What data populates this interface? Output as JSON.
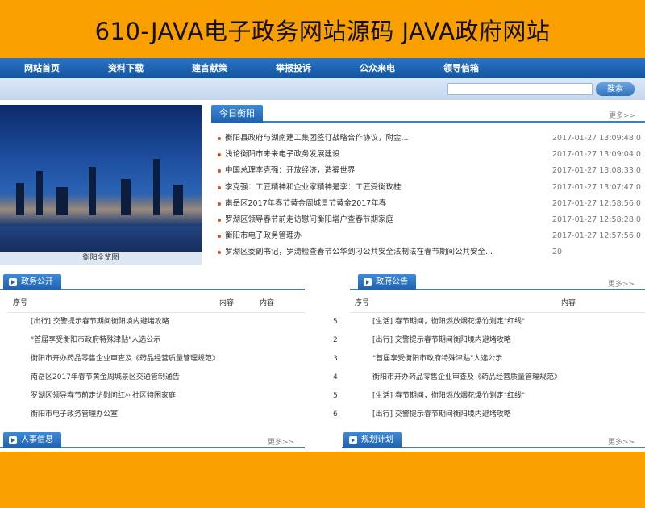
{
  "banner": {
    "title": "610-JAVA电子政务网站源码 JAVA政府网站"
  },
  "nav": {
    "items": [
      "网站首页",
      "资料下载",
      "建言献策",
      "举报投诉",
      "公众来电",
      "领导信箱"
    ]
  },
  "search": {
    "button_label": "搜索",
    "value": ""
  },
  "hero": {
    "caption": "衡阳全览图"
  },
  "news": {
    "tab_label": "今日衡阳",
    "more_label": "更多>>",
    "items": [
      {
        "title": "衡阳县政府与湖南建工集团签订战略合作协议，附金...",
        "date": "2017-01-27 13:09:48.0"
      },
      {
        "title": "浅论衡阳市未来电子政务发展建设",
        "date": "2017-01-27 13:09:04.0"
      },
      {
        "title": "中国总理李克强：开放经济，造福世界",
        "date": "2017-01-27 13:08:33.0"
      },
      {
        "title": "李克强：工匠精神和企业家精神是孪：工匠受衡玫桂",
        "date": "2017-01-27 13:07:47.0"
      },
      {
        "title": "南岳区2017年春节黄金周城景节黄金2017年春",
        "date": "2017-01-27 12:58:56.0"
      },
      {
        "title": "罗湖区领导春节前走访慰问衡阳增户查春节期家庭",
        "date": "2017-01-27 12:58:28.0"
      },
      {
        "title": "衡阳市电子政务管理办",
        "date": "2017-01-27 12:57:56.0"
      },
      {
        "title": "罗湖区委副书记，罗涛检查春节公华到刁公共安全法制法在春节期间公共安全...",
        "date": "20"
      }
    ]
  },
  "gov_open": {
    "tab_label": "政务公开",
    "col_seq": "序号",
    "col_content": "内容",
    "col_content2": "内容",
    "rows": [
      "[出行] 交警提示春节期间衡阳境内避堵攻略",
      "\"首届享受衡阳市政府特殊津贴\"人选公示",
      "衡阳市开办药品零售企业审查及《药品经营质量管理规范》",
      "南岳区2017年春节黄金周城景区交通管制通告",
      "罗湖区领导春节前走访慰问红村社区特困家庭",
      "衡阳市电子政务管理办公室"
    ]
  },
  "notice": {
    "tab_label": "政府公告",
    "more_label": "更多>>",
    "col_seq": "序号",
    "col_content": "内容",
    "rows": [
      {
        "seq": "5",
        "text": "[生活] 春节期间，衡阳燃放烟花爆竹划定\"红线\""
      },
      {
        "seq": "2",
        "text": "[出行] 交警提示春节期间衡阳境内避堵攻略"
      },
      {
        "seq": "3",
        "text": "\"首届享受衡阳市政府特殊津贴\"人选公示"
      },
      {
        "seq": "4",
        "text": "衡阳市开办药品零售企业审查及《药品经营质量管理规范》"
      },
      {
        "seq": "5",
        "text": "[生活] 春节期间，衡阳燃放烟花爆竹划定\"红线\""
      },
      {
        "seq": "6",
        "text": "[出行] 交警提示春节期间衡阳境内避堵攻略"
      }
    ]
  },
  "hr": {
    "tab_label": "人事信息",
    "more_label": "更多>>"
  },
  "plan": {
    "tab_label": "规划计划",
    "more_label": "更多>>"
  },
  "colors": {
    "banner_bg": "#f9a000",
    "nav_blue": "#1d61b0",
    "accent_blue": "#3a7fce",
    "bullet": "#d9541e"
  }
}
